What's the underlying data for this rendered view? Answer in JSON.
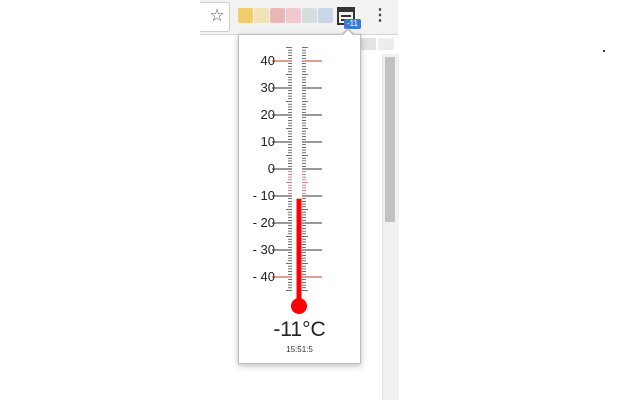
{
  "browser": {
    "star_glyph": "☆",
    "menu_glyph": "⋮",
    "extension_icon_colors": [
      "#f2cb6b",
      "#efe2b4",
      "#e8b7b7",
      "#efc9cd",
      "#d5dede",
      "#c8d6e8"
    ],
    "badge_text": "-11",
    "badge_color": "#3b79d6"
  },
  "thermometer": {
    "scale_labels": [
      "40",
      "30",
      "20",
      "10",
      "0",
      "- 10",
      "- 20",
      "- 30",
      "- 40"
    ],
    "scale_values": [
      40,
      30,
      20,
      10,
      0,
      -10,
      -20,
      -30,
      -40
    ],
    "scale_min": -40,
    "scale_max": 40,
    "current_value": -11,
    "mercury_color": "#ff0000",
    "reading": "-11°C",
    "timestamp": "15:51:5"
  }
}
